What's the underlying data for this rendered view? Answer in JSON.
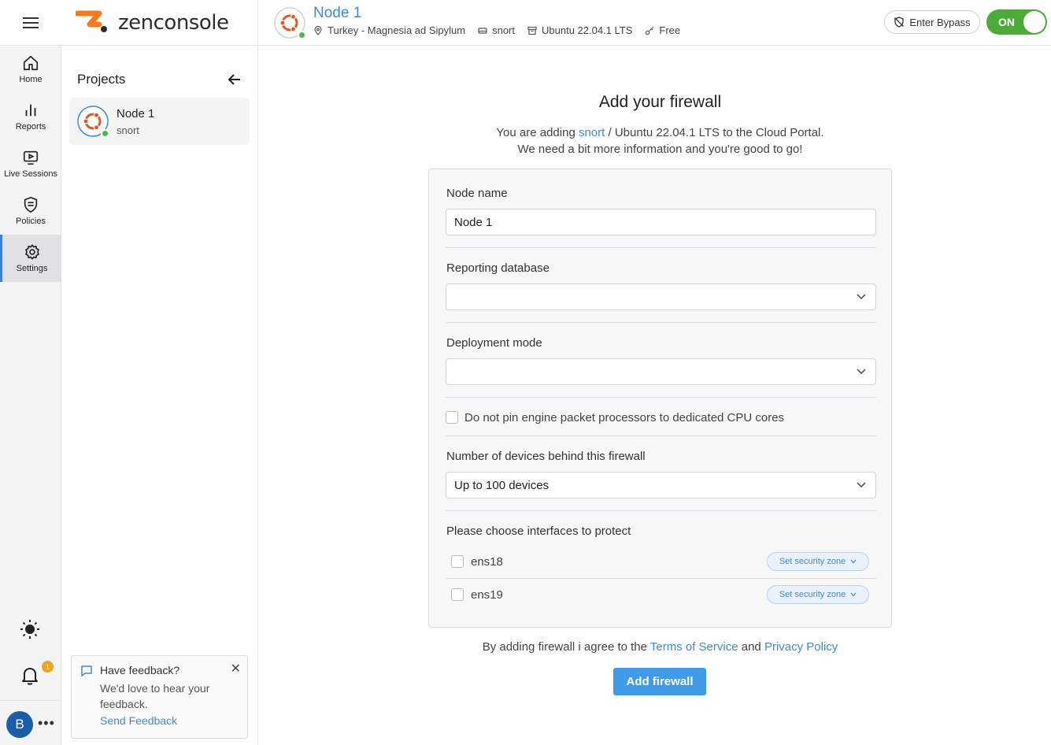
{
  "brand": {
    "name": "zenconsole",
    "accent": "#f47a20"
  },
  "nav": {
    "items": [
      {
        "label": "Home",
        "icon": "home-icon"
      },
      {
        "label": "Reports",
        "icon": "bar-chart-icon"
      },
      {
        "label": "Live Sessions",
        "icon": "play-screen-icon"
      },
      {
        "label": "Policies",
        "icon": "shield-icon"
      },
      {
        "label": "Settings",
        "icon": "gear-icon",
        "active": true
      }
    ],
    "notification_count": "1",
    "avatar_initial": "B",
    "more": "•••"
  },
  "projects": {
    "title": "Projects",
    "items": [
      {
        "name": "Node 1",
        "sub": "snort"
      }
    ]
  },
  "feedback": {
    "title": "Have feedback?",
    "body": "We'd love to hear your feedback.",
    "link": "Send Feedback",
    "close": "✕"
  },
  "header": {
    "title": "Node 1",
    "location": "Turkey - Magnesia ad Sipylum",
    "engine": "snort",
    "os": "Ubuntu 22.04.1 LTS",
    "plan": "Free",
    "bypass_label": "Enter Bypass",
    "toggle_label": "ON"
  },
  "main": {
    "title": "Add your firewall",
    "sub_prefix": "You are adding ",
    "sub_link": "snort",
    "sub_suffix": " / Ubuntu 22.04.1 LTS to the Cloud Portal.",
    "sub_line2": "We need a bit more information and you're good to go!"
  },
  "form": {
    "node_name_label": "Node name",
    "node_name_value": "Node 1",
    "reporting_db_label": "Reporting database",
    "reporting_db_value": "",
    "deployment_mode_label": "Deployment mode",
    "deployment_mode_value": "",
    "pin_cores_label": "Do not pin engine packet processors to dedicated CPU cores",
    "devices_label": "Number of devices behind this firewall",
    "devices_value": "Up to 100 devices",
    "interfaces_label": "Please choose interfaces to protect",
    "interfaces": [
      {
        "name": "ens18",
        "zone_label": "Set security zone"
      },
      {
        "name": "ens19",
        "zone_label": "Set security zone"
      }
    ]
  },
  "footer": {
    "agree_prefix": "By adding firewall i agree to the ",
    "terms": "Terms of Service",
    "and": " and ",
    "privacy": "Privacy Policy",
    "add_button": "Add firewall"
  }
}
